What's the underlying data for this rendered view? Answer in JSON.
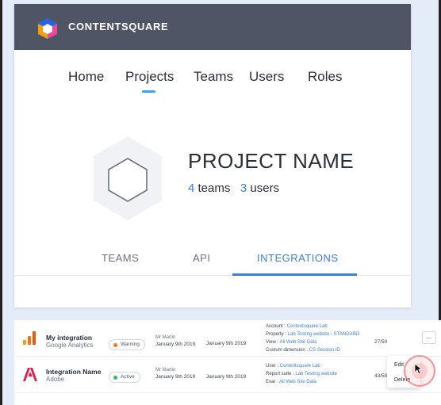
{
  "app": {
    "brand": "CONTENTSQUARE"
  },
  "nav": {
    "items": [
      {
        "label": "Home"
      },
      {
        "label": "Projects",
        "active": true
      },
      {
        "label": "Teams"
      },
      {
        "label": "Users"
      },
      {
        "label": "Roles"
      }
    ]
  },
  "project": {
    "name": "PROJECT NAME",
    "teams_count": "4",
    "teams_label": "teams",
    "users_count": "3",
    "users_label": "users"
  },
  "tabs": {
    "items": [
      {
        "label": "TEAMS"
      },
      {
        "label": "API"
      },
      {
        "label": "INTEGRATIONS",
        "active": true
      }
    ]
  },
  "integrations": [
    {
      "icon": "google-analytics-icon",
      "name": "My integration",
      "type": "Google Analytics",
      "status": "Warning",
      "status_color": "#f97316",
      "author": "Mr Martin",
      "author_date": "January 9th 2019",
      "date": "January 9th 2019",
      "details": [
        {
          "key": "Account : ",
          "value": "Contentsquare Lab"
        },
        {
          "key": "Property : ",
          "value": "Lab Testing website - STANDARD"
        },
        {
          "key": "View : ",
          "value": "All Web Site Data"
        },
        {
          "key": "Custom dimension : ",
          "value": "CS Session ID"
        }
      ],
      "count": "27/50"
    },
    {
      "icon": "adobe-icon",
      "name": "Integration Name",
      "type": "Adobe",
      "status": "Active",
      "status_color": "#22c55e",
      "author": "Mr Martin",
      "author_date": "January 9th 2019",
      "date": "January 9th 2019",
      "details": [
        {
          "key": "User : ",
          "value": "Contentsquare Lab"
        },
        {
          "key": "Report suite : ",
          "value": "Lab Testing website"
        },
        {
          "key": "Evar : ",
          "value": "All Web Site Data"
        }
      ],
      "count": "43/50"
    }
  ],
  "actions": {
    "more_label": "...",
    "edit_label": "Edit",
    "delete_label": "Delete"
  },
  "colors": {
    "header_bg": "#4f5565",
    "accent": "#3a7fe0",
    "nav_indicator": "#3aa0ff"
  }
}
